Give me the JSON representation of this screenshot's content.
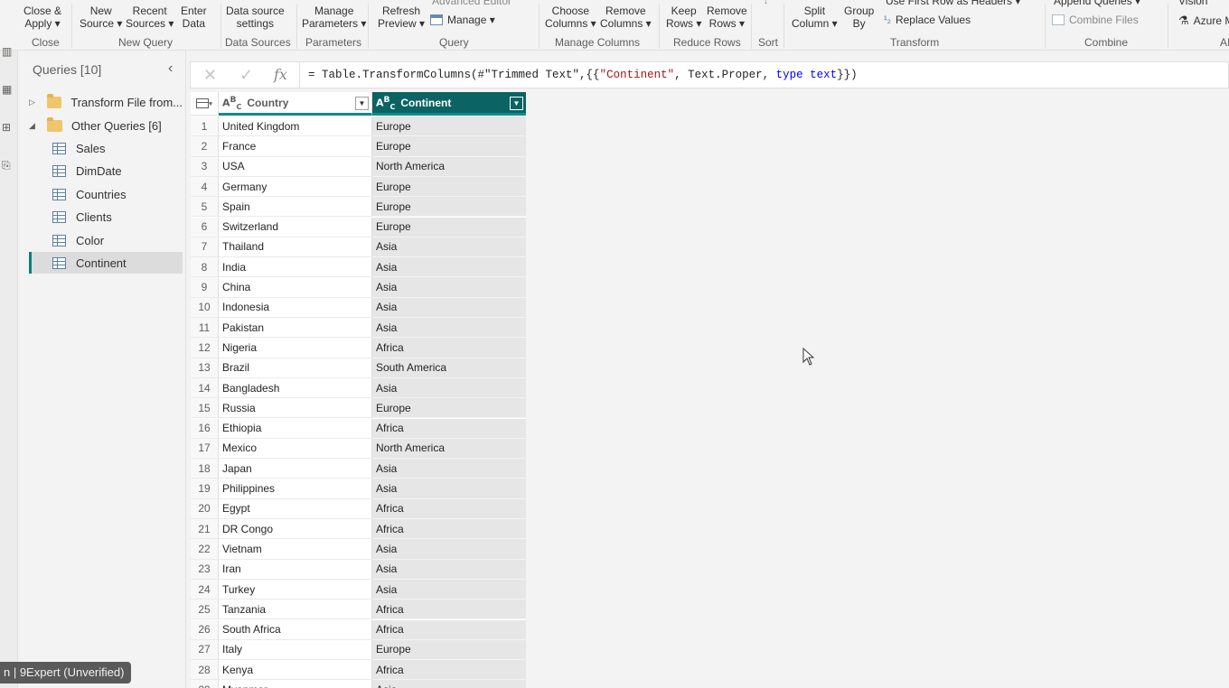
{
  "ribbon": {
    "buttons": [
      {
        "id": "close-apply",
        "l1": "Close &",
        "l2": "Apply ▾"
      },
      {
        "id": "new-source",
        "l1": "New",
        "l2": "Source ▾"
      },
      {
        "id": "recent-sources",
        "l1": "Recent",
        "l2": "Sources ▾"
      },
      {
        "id": "enter-data",
        "l1": "Enter",
        "l2": "Data"
      },
      {
        "id": "data-source-settings",
        "l1": "Data source",
        "l2": "settings"
      },
      {
        "id": "manage-parameters",
        "l1": "Manage",
        "l2": "Parameters ▾"
      },
      {
        "id": "refresh-preview",
        "l1": "Refresh",
        "l2": "Preview ▾"
      },
      {
        "id": "choose-columns",
        "l1": "Choose",
        "l2": "Columns ▾"
      },
      {
        "id": "remove-columns",
        "l1": "Remove",
        "l2": "Columns ▾"
      },
      {
        "id": "keep-rows",
        "l1": "Keep",
        "l2": "Rows ▾"
      },
      {
        "id": "remove-rows",
        "l1": "Remove",
        "l2": "Rows ▾"
      },
      {
        "id": "split-column",
        "l1": "Split",
        "l2": "Column ▾"
      },
      {
        "id": "group-by",
        "l1": "Group",
        "l2": "By"
      }
    ],
    "small": {
      "advanced_editor": "Advanced Editor",
      "manage": "Manage ▾",
      "use_first_row": "Use First Row as Headers ▾",
      "replace_values": "Replace Values",
      "append_queries": "Append Queries ▾",
      "combine_files": "Combine Files",
      "vision": "Vision",
      "azure": "Azure M"
    },
    "groups": {
      "close": "Close",
      "new_query": "New Query",
      "data_sources": "Data Sources",
      "parameters": "Parameters",
      "query": "Query",
      "manage_columns": "Manage Columns",
      "reduce_rows": "Reduce Rows",
      "sort": "Sort",
      "transform": "Transform",
      "combine": "Combine",
      "ai": "AI"
    }
  },
  "queries": {
    "title": "Queries [10]",
    "items": [
      {
        "label": "Transform File from...",
        "kind": "folder",
        "expanded": false
      },
      {
        "label": "Other Queries [6]",
        "kind": "folder",
        "expanded": true
      },
      {
        "label": "Sales",
        "kind": "table"
      },
      {
        "label": "DimDate",
        "kind": "table"
      },
      {
        "label": "Countries",
        "kind": "table"
      },
      {
        "label": "Clients",
        "kind": "table"
      },
      {
        "label": "Color",
        "kind": "table"
      },
      {
        "label": "Continent",
        "kind": "table",
        "selected": true
      }
    ]
  },
  "formula": {
    "prefix": "= Table.TransformColumns(#\"Trimmed Text\",{{",
    "str1": "\"Continent\"",
    "mid": ", Text.Proper, ",
    "kw": "type text",
    "suffix": "}})"
  },
  "table": {
    "columns": [
      "Country",
      "Continent"
    ],
    "rows": [
      [
        "United Kingdom",
        "Europe"
      ],
      [
        "France",
        "Europe"
      ],
      [
        "USA",
        "North America"
      ],
      [
        "Germany",
        "Europe"
      ],
      [
        "Spain",
        "Europe"
      ],
      [
        "Switzerland",
        "Europe"
      ],
      [
        "Thailand",
        "Asia"
      ],
      [
        "India",
        "Asia"
      ],
      [
        "China",
        "Asia"
      ],
      [
        "Indonesia",
        "Asia"
      ],
      [
        "Pakistan",
        "Asia"
      ],
      [
        "Nigeria",
        "Africa"
      ],
      [
        "Brazil",
        "South America"
      ],
      [
        "Bangladesh",
        "Asia"
      ],
      [
        "Russia",
        "Europe"
      ],
      [
        "Ethiopia",
        "Africa"
      ],
      [
        "Mexico",
        "North America"
      ],
      [
        "Japan",
        "Asia"
      ],
      [
        "Philippines",
        "Asia"
      ],
      [
        "Egypt",
        "Africa"
      ],
      [
        "DR Congo",
        "Africa"
      ],
      [
        "Vietnam",
        "Asia"
      ],
      [
        "Iran",
        "Asia"
      ],
      [
        "Turkey",
        "Asia"
      ],
      [
        "Tanzania",
        "Africa"
      ],
      [
        "South Africa",
        "Africa"
      ],
      [
        "Italy",
        "Europe"
      ],
      [
        "Kenya",
        "Africa"
      ],
      [
        "Myanmar",
        "Asia"
      ]
    ]
  },
  "watermark": "n | 9Expert (Unverified)",
  "colors": {
    "accent": "#0b6363",
    "selected_header_underline": "#0f8b8b"
  }
}
